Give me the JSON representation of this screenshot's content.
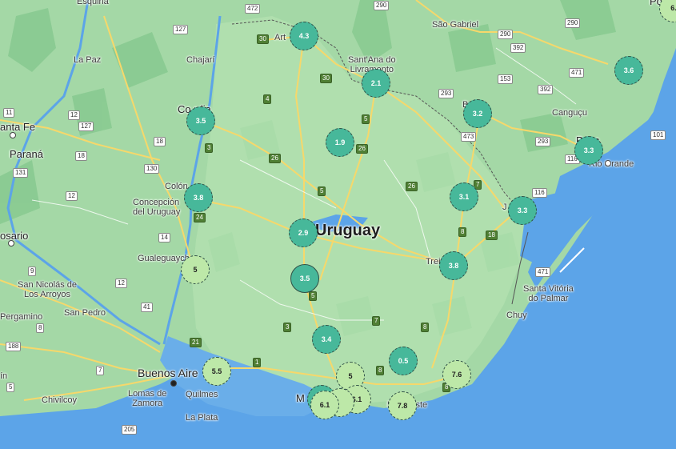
{
  "country_label": "Uruguay",
  "place_labels": [
    {
      "id": "esquina",
      "text": "Esquina"
    },
    {
      "id": "la-paz",
      "text": "La Paz"
    },
    {
      "id": "chajari",
      "text": "Chajarí"
    },
    {
      "id": "santa-fe",
      "text": "anta Fe"
    },
    {
      "id": "parana",
      "text": "Paraná"
    },
    {
      "id": "concordia",
      "text": "Co   rdia"
    },
    {
      "id": "colon",
      "text": "Colón"
    },
    {
      "id": "concepcion",
      "text": "Concepción\ndel Uruguay"
    },
    {
      "id": "rosario",
      "text": "osario"
    },
    {
      "id": "gualeguaychu",
      "text": "Gualeguaych"
    },
    {
      "id": "san-nicolas",
      "text": "San Nicolás de\nLos Arroyos"
    },
    {
      "id": "san-pedro",
      "text": "San Pedro"
    },
    {
      "id": "pergamino",
      "text": "Pergamino"
    },
    {
      "id": "buenos-aires",
      "text": "Buenos Aire"
    },
    {
      "id": "lomas",
      "text": "Lomas de\nZamora"
    },
    {
      "id": "quilmes",
      "text": "Quilmes"
    },
    {
      "id": "la-plata",
      "text": "La Plata"
    },
    {
      "id": "chivilcoy",
      "text": "Chivilcoy"
    },
    {
      "id": "jun",
      "text": "ín"
    },
    {
      "id": "artigas",
      "text": "Art"
    },
    {
      "id": "santana",
      "text": "Sant'Ana do\nLivramento"
    },
    {
      "id": "sao-gabriel",
      "text": "São Gabriel"
    },
    {
      "id": "bage",
      "text": "B"
    },
    {
      "id": "cangucu",
      "text": "Canguçu"
    },
    {
      "id": "pelotas",
      "text": "P     tas"
    },
    {
      "id": "rio-grande",
      "text": "Rio Grande"
    },
    {
      "id": "jaguarao",
      "text": "J"
    },
    {
      "id": "treinta",
      "text": "Trei           res"
    },
    {
      "id": "santa-vitoria",
      "text": "Santa Vitória\ndo Palmar"
    },
    {
      "id": "chuy",
      "text": "Chuy"
    },
    {
      "id": "montevideo",
      "text": "M"
    },
    {
      "id": "punta",
      "text": "Pu       el Este"
    },
    {
      "id": "porto",
      "text": "Port"
    }
  ],
  "road_shields": [
    {
      "id": "r472",
      "text": "472",
      "kind": "br"
    },
    {
      "id": "r290",
      "text": "290",
      "kind": "br"
    },
    {
      "id": "r290b",
      "text": "290",
      "kind": "br"
    },
    {
      "id": "r290c",
      "text": "290",
      "kind": "br"
    },
    {
      "id": "r392",
      "text": "392",
      "kind": "br"
    },
    {
      "id": "r153",
      "text": "153",
      "kind": "br"
    },
    {
      "id": "r471",
      "text": "471",
      "kind": "br"
    },
    {
      "id": "r392b",
      "text": "392",
      "kind": "br"
    },
    {
      "id": "r293",
      "text": "293",
      "kind": "br"
    },
    {
      "id": "r293b",
      "text": "293",
      "kind": "br"
    },
    {
      "id": "r473",
      "text": "473",
      "kind": "br"
    },
    {
      "id": "r116",
      "text": "116",
      "kind": "br"
    },
    {
      "id": "r116b",
      "text": "116",
      "kind": "br"
    },
    {
      "id": "r101",
      "text": "101",
      "kind": "br"
    },
    {
      "id": "r471b",
      "text": "471",
      "kind": "br"
    },
    {
      "id": "r127",
      "text": "127",
      "kind": "br"
    },
    {
      "id": "r127b",
      "text": "127",
      "kind": "br"
    },
    {
      "id": "r12",
      "text": "12",
      "kind": "br"
    },
    {
      "id": "r12b",
      "text": "12",
      "kind": "br"
    },
    {
      "id": "r12c",
      "text": "12",
      "kind": "br"
    },
    {
      "id": "r11",
      "text": "11",
      "kind": "br"
    },
    {
      "id": "r18",
      "text": "18",
      "kind": "br"
    },
    {
      "id": "r18b",
      "text": "18",
      "kind": "br"
    },
    {
      "id": "r130",
      "text": "130",
      "kind": "br"
    },
    {
      "id": "r131",
      "text": "131",
      "kind": "br"
    },
    {
      "id": "r14",
      "text": "14",
      "kind": "br"
    },
    {
      "id": "r9",
      "text": "9",
      "kind": "br"
    },
    {
      "id": "r8",
      "text": "8",
      "kind": "br"
    },
    {
      "id": "r188",
      "text": "188",
      "kind": "br"
    },
    {
      "id": "r5b",
      "text": "5",
      "kind": "br"
    },
    {
      "id": "r7b",
      "text": "7",
      "kind": "br"
    },
    {
      "id": "r205",
      "text": "205",
      "kind": "br"
    },
    {
      "id": "r41",
      "text": "41",
      "kind": "br"
    },
    {
      "id": "r30",
      "text": "30",
      "kind": "uy"
    },
    {
      "id": "r30b",
      "text": "30",
      "kind": "uy"
    },
    {
      "id": "r4",
      "text": "4",
      "kind": "uy"
    },
    {
      "id": "r5",
      "text": "5",
      "kind": "uy"
    },
    {
      "id": "r26",
      "text": "26",
      "kind": "uy"
    },
    {
      "id": "r26b",
      "text": "26",
      "kind": "uy"
    },
    {
      "id": "r26c",
      "text": "26",
      "kind": "uy"
    },
    {
      "id": "r3",
      "text": "3",
      "kind": "uy"
    },
    {
      "id": "r3b",
      "text": "3",
      "kind": "uy"
    },
    {
      "id": "r24",
      "text": "24",
      "kind": "uy"
    },
    {
      "id": "r5c",
      "text": "5",
      "kind": "uy"
    },
    {
      "id": "r5d",
      "text": "5",
      "kind": "uy"
    },
    {
      "id": "r7",
      "text": "7",
      "kind": "uy"
    },
    {
      "id": "r7c",
      "text": "7",
      "kind": "uy"
    },
    {
      "id": "r8u",
      "text": "8",
      "kind": "uy"
    },
    {
      "id": "r8v",
      "text": "8",
      "kind": "uy"
    },
    {
      "id": "r8w",
      "text": "8",
      "kind": "uy"
    },
    {
      "id": "r18u",
      "text": "18",
      "kind": "uy"
    },
    {
      "id": "r21",
      "text": "21",
      "kind": "uy"
    },
    {
      "id": "r1",
      "text": "1",
      "kind": "uy"
    },
    {
      "id": "r8x",
      "text": "8",
      "kind": "uy"
    }
  ],
  "clusters": [
    {
      "id": "c43",
      "value": "4.3",
      "style": "dark"
    },
    {
      "id": "c21",
      "value": "2.1",
      "style": "dark"
    },
    {
      "id": "c36",
      "value": "3.6",
      "style": "dark"
    },
    {
      "id": "c32",
      "value": "3.2",
      "style": "dark"
    },
    {
      "id": "c35a",
      "value": "3.5",
      "style": "dark"
    },
    {
      "id": "c19",
      "value": "1.9",
      "style": "dark"
    },
    {
      "id": "c33a",
      "value": "3.3",
      "style": "dark"
    },
    {
      "id": "c38a",
      "value": "3.8",
      "style": "dark"
    },
    {
      "id": "c31",
      "value": "3.1",
      "style": "dark"
    },
    {
      "id": "c33b",
      "value": "3.3",
      "style": "dark"
    },
    {
      "id": "c29",
      "value": "2.9",
      "style": "dark"
    },
    {
      "id": "c5a",
      "value": "5",
      "style": "light"
    },
    {
      "id": "c38b",
      "value": "3.8",
      "style": "dark"
    },
    {
      "id": "c35b",
      "value": "3.5",
      "style": "dark"
    },
    {
      "id": "c34",
      "value": "3.4",
      "style": "dark"
    },
    {
      "id": "c55",
      "value": "5.5",
      "style": "light"
    },
    {
      "id": "c05",
      "value": "0.5",
      "style": "dark"
    },
    {
      "id": "c76",
      "value": "7.6",
      "style": "light"
    },
    {
      "id": "c5b",
      "value": "5",
      "style": "light"
    },
    {
      "id": "cM",
      "value": "",
      "style": "dark"
    },
    {
      "id": "c61b",
      "value": "6.1",
      "style": "light"
    },
    {
      "id": "cMid",
      "value": "",
      "style": "light"
    },
    {
      "id": "c61a",
      "value": "6.1",
      "style": "light"
    },
    {
      "id": "c78",
      "value": "7.8",
      "style": "light"
    },
    {
      "id": "c6top",
      "value": "6.",
      "style": "light"
    }
  ]
}
